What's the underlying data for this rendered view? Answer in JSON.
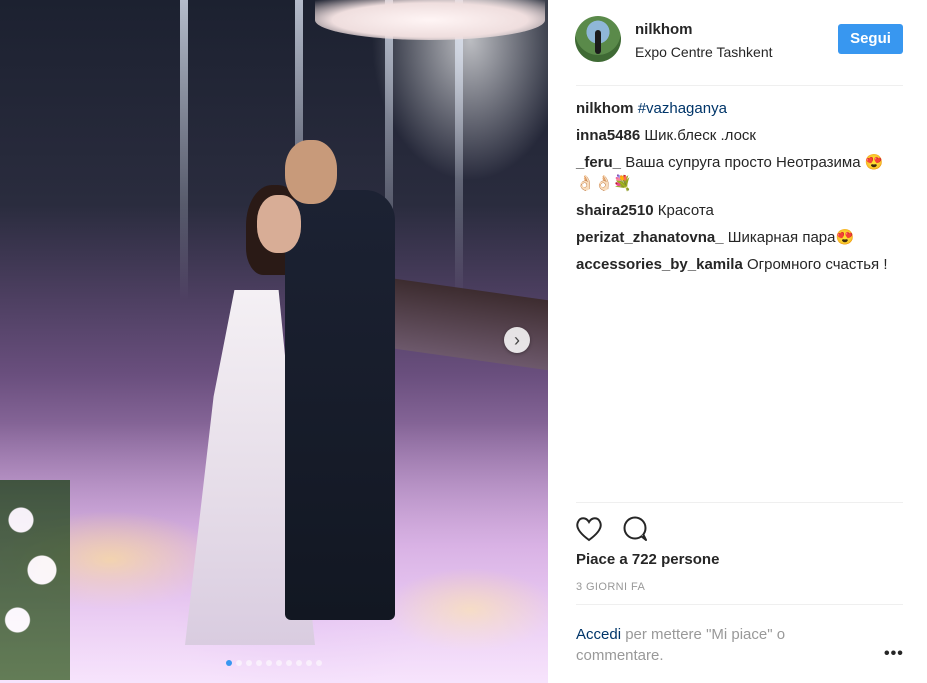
{
  "post": {
    "carousel": {
      "slide_count": 10,
      "active_index": 0
    }
  },
  "header": {
    "username": "nilkhom",
    "location": "Expo Centre Tashkent",
    "follow_label": "Segui"
  },
  "caption": {
    "username": "nilkhom",
    "hashtag": "#vazhaganya"
  },
  "comments": [
    {
      "username": "inna5486",
      "text": "Шик.блеск .лоск"
    },
    {
      "username": "_feru_",
      "text": "Ваша супруга просто Неотразима 😍👌🏻👌🏻💐"
    },
    {
      "username": "shaira2510",
      "text": "Красота"
    },
    {
      "username": "perizat_zhanatovna_",
      "text": "Шикарная пара😍"
    },
    {
      "username": "accessories_by_kamila",
      "text": "Огромного счастья !"
    }
  ],
  "actions": {
    "like_icon": "heart-icon",
    "comment_icon": "comment-bubble-icon"
  },
  "likes_text": "Piace a 722 persone",
  "timestamp": "3 GIORNI FA",
  "login_prompt": {
    "link": "Accedi",
    "text": " per mettere \"Mi piace\" o commentare."
  },
  "more_label": "•••",
  "colors": {
    "accent": "#3897f0",
    "link": "#003569",
    "muted": "#999999"
  }
}
